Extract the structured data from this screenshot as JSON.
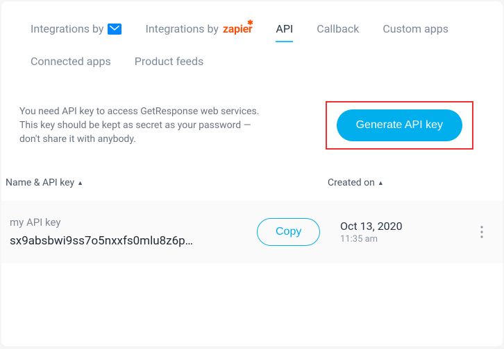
{
  "tabs": {
    "integrations_mail": "Integrations by",
    "integrations_zapier_prefix": "Integrations by",
    "integrations_zapier_brand": "zapier",
    "api": "API",
    "callback": "Callback",
    "custom_apps": "Custom apps",
    "connected_apps": "Connected apps",
    "product_feeds": "Product feeds"
  },
  "info": {
    "text": "You need API key to access GetResponse web services. This key should be kept as secret as your password — don't share it with anybody."
  },
  "buttons": {
    "generate": "Generate API key",
    "copy": "Copy"
  },
  "headers": {
    "name_key": "Name & API key",
    "created": "Created on"
  },
  "row": {
    "name": "my API key",
    "key": "sx9absbwi9ss7o5nxxfs0mlu8z6p…",
    "date": "Oct 13, 2020",
    "time": "11:35 am"
  }
}
